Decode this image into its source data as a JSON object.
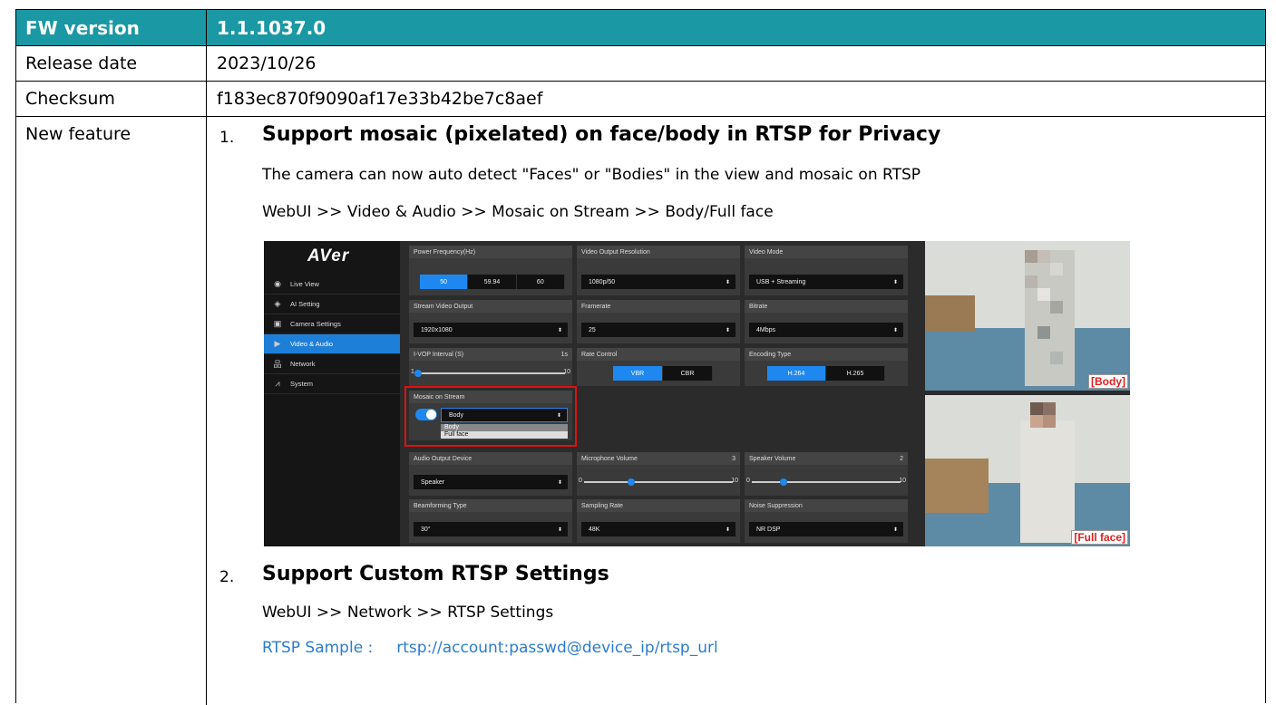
{
  "fw_version": {
    "label": "FW version",
    "value": "1.1.1037.0"
  },
  "release_date": {
    "label": "Release date",
    "value": "2023/10/26"
  },
  "checksum": {
    "label": "Checksum",
    "value": "f183ec870f9090af17e33b42be7c8aef"
  },
  "new_feature": {
    "label": "New feature",
    "items": [
      {
        "num": "1.",
        "title": "Support mosaic (pixelated) on face/body in RTSP for Privacy",
        "desc": "The camera can now auto detect \"Faces\" or \"Bodies\" in the view and mosaic on RTSP",
        "path": "WebUI >> Video & Audio >> Mosaic on Stream >> Body/Full face"
      },
      {
        "num": "2.",
        "title": "Support Custom RTSP Settings",
        "path": "WebUI >> Network >> RTSP Settings",
        "sample_label": "RTSP Sample :",
        "sample_url": "rtsp://account:passwd@device_ip/rtsp_url"
      }
    ]
  },
  "screenshot": {
    "logo": "AVer",
    "nav": [
      "Live View",
      "AI Setting",
      "Camera Settings",
      "Video & Audio",
      "Network",
      "System"
    ],
    "active_nav": "Video & Audio",
    "power_frequency": {
      "label": "Power Frequency(Hz)",
      "options": [
        "50",
        "59.94",
        "60"
      ],
      "selected": "50"
    },
    "video_output_resolution": {
      "label": "Video Output Resolution",
      "value": "1080p/50"
    },
    "video_mode": {
      "label": "Video Mode",
      "value": "USB + Streaming"
    },
    "stream_video_output": {
      "label": "Stream Video Output",
      "value": "1920x1080"
    },
    "framerate": {
      "label": "Framerate",
      "value": "25"
    },
    "bitrate": {
      "label": "Bitrate",
      "value": "4Mbps"
    },
    "ivop_interval": {
      "label": "I-VOP Interval (S)",
      "value": "1s",
      "min": "1",
      "max": "10",
      "level": 0
    },
    "rate_control": {
      "label": "Rate Control",
      "options": [
        "VBR",
        "CBR"
      ],
      "selected": "VBR"
    },
    "encoding_type": {
      "label": "Encoding Type",
      "options": [
        "H.264",
        "H.265"
      ],
      "selected": "H.264"
    },
    "mosaic_on_stream": {
      "label": "Mosaic on Stream",
      "value": "Body",
      "options": [
        "Body",
        "Full face"
      ]
    },
    "audio_output_device": {
      "label": "Audio Output Device",
      "value": "Speaker"
    },
    "microphone_volume": {
      "label": "Microphone Volume",
      "value": "3",
      "min": "0",
      "max": "10",
      "level": 0.3
    },
    "speaker_volume": {
      "label": "Speaker Volume",
      "value": "2",
      "min": "0",
      "max": "10",
      "level": 0.2
    },
    "beamforming_type": {
      "label": "Beamforming Type",
      "value": "30°"
    },
    "sampling_rate": {
      "label": "Sampling Rate",
      "value": "48K"
    },
    "noise_suppression": {
      "label": "Noise Suppression",
      "value": "NR DSP"
    },
    "photo_tags": [
      "[Body]",
      "[Full face]"
    ]
  },
  "colors": {
    "header_bg": "#1a98a4",
    "accent_blue": "#1e88f0",
    "highlight_red": "#e01010",
    "link_blue": "#2b7bd0"
  }
}
